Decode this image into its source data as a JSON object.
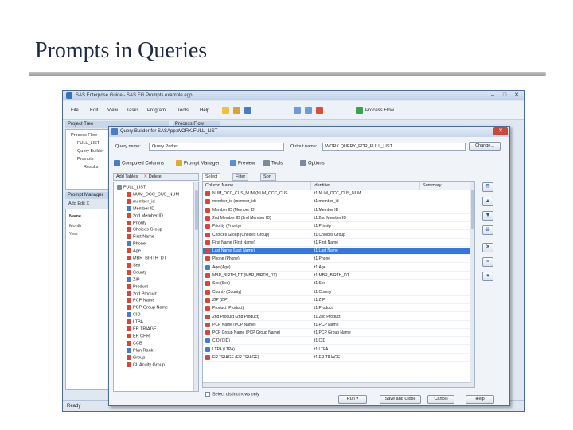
{
  "slide": {
    "title": "Prompts in Queries"
  },
  "app": {
    "title": "SAS Enterprise Guide - SAS EG Prompts example.egp",
    "menu": [
      "File",
      "Edit",
      "View",
      "Tasks",
      "Program",
      "Tools",
      "Help"
    ],
    "process_flow_label": "Process Flow",
    "project_tree_label": "Project Tree",
    "tree_items": [
      "Process Flow",
      "FULL_LIST",
      "Query Builder",
      "Prompts",
      "Results"
    ],
    "flow_tab": "Process Flow",
    "prompt_manager_label": "Prompt Manager",
    "pm_toolbar": "Add  Edit  X",
    "pm_column": "Name",
    "pm_items": [
      "Month",
      "Year"
    ],
    "status": "Ready"
  },
  "dialog": {
    "title": "Query Builder for SASApp:WORK.FULL_LIST",
    "query_name_label": "Query name:",
    "query_name": "Query Parker",
    "output_name_label": "Output name:",
    "output_name": "WORK.QUERY_FOR_FULL_LIST",
    "change_button": "Change...",
    "toolbar": {
      "computed_columns": "Computed Columns",
      "prompt_manager": "Prompt Manager",
      "preview": "Preview",
      "tools": "Tools",
      "options": "Options"
    },
    "tree_toolbar": {
      "add_tables": "Add Tables",
      "delete": "Delete"
    },
    "tree": [
      "FULL_LIST",
      "NUM_OCC_CUS_NUM",
      "member_id",
      "Member ID",
      "2nd Member ID",
      "Priority",
      "Choices Group",
      "First Name",
      "Phone",
      "Age",
      "MBR_BIRTH_DT",
      "Sex",
      "County",
      "ZIP",
      "Product",
      "2nd Product",
      "PCP Name",
      "PCP Group Name",
      "CID",
      "LTPA",
      "ER TRIAGE",
      "ER CHR",
      "CCB",
      "Plan Rank",
      "Group",
      "CL Acuity Group"
    ],
    "tabs": [
      "Select Data",
      "Filter Data",
      "Sort Data"
    ],
    "columns": [
      "Column Name",
      "Identifier",
      "Summary"
    ],
    "rows": [
      {
        "name": "NUM_OCC_CUS_NUM (NUM_OCC_CUS...",
        "id": "t1.NUM_OCC_CUS_NUM",
        "sel": false
      },
      {
        "name": "member_id (member_id)",
        "id": "t1.member_id",
        "sel": false
      },
      {
        "name": "Member ID (Member ID)",
        "id": "t1.Member ID",
        "sel": false
      },
      {
        "name": "2nd Member ID (2nd Member ID)",
        "id": "t1.2nd Member ID",
        "sel": false
      },
      {
        "name": "Priority (Priority)",
        "id": "t1.Priority",
        "sel": false
      },
      {
        "name": "Choices Group (Choices Group)",
        "id": "t1.Choices Group",
        "sel": false
      },
      {
        "name": "First Name (First Name)",
        "id": "t1.First Name",
        "sel": false
      },
      {
        "name": "Last Name (Last Name)",
        "id": "t1.Last Name",
        "sel": true
      },
      {
        "name": "Phone (Phone)",
        "id": "t1.Phone",
        "sel": false
      },
      {
        "name": "Age (Age)",
        "id": "t1.Age",
        "sel": false
      },
      {
        "name": "MBR_BIRTH_DT (MBR_BIRTH_DT)",
        "id": "t1.MBR_BIRTH_DT",
        "sel": false
      },
      {
        "name": "Sex (Sex)",
        "id": "t1.Sex",
        "sel": false
      },
      {
        "name": "County (County)",
        "id": "t1.County",
        "sel": false
      },
      {
        "name": "ZIP (ZIP)",
        "id": "t1.ZIP",
        "sel": false
      },
      {
        "name": "Product (Product)",
        "id": "t1.Product",
        "sel": false
      },
      {
        "name": "2nd Product (2nd Product)",
        "id": "t1.2nd Product",
        "sel": false
      },
      {
        "name": "PCP Name (PCP Name)",
        "id": "t1.PCP Name",
        "sel": false
      },
      {
        "name": "PCP Group Name (PCP Group Name)",
        "id": "t1.PCP Group Name",
        "sel": false
      },
      {
        "name": "CID (CID)",
        "id": "t1.CID",
        "sel": false
      },
      {
        "name": "LTPA (LTPA)",
        "id": "t1.LTPA",
        "sel": false
      },
      {
        "name": "ER TRIAGE (ER TRIAGE)",
        "id": "t1.ER TRIAGE",
        "sel": false
      }
    ],
    "distinct_label": "Select distinct rows only",
    "buttons": {
      "run": "Run",
      "save_close": "Save and Close",
      "cancel": "Cancel",
      "help": "Help"
    }
  },
  "colors": {
    "selection": "#3875d7",
    "title_text": "#1f2a44"
  }
}
